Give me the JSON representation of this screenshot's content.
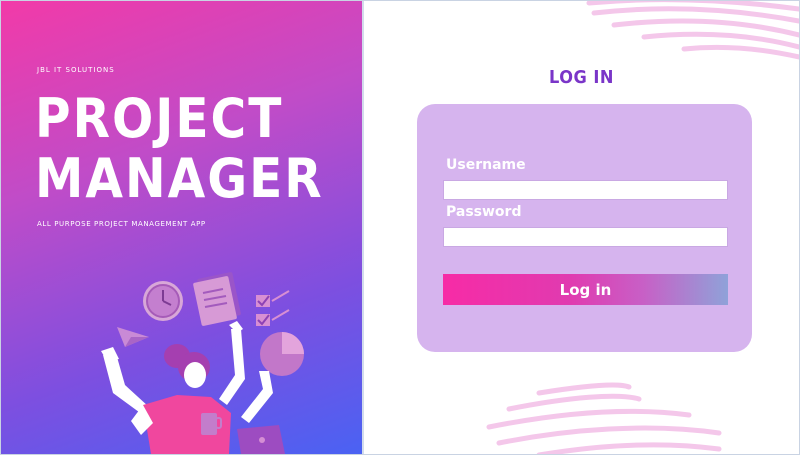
{
  "brand": {
    "company": "JBL IT SOLUTIONS",
    "title_line1": "PROJECT",
    "title_line2": "MANAGER",
    "tagline": "ALL PURPOSE PROJECT MANAGEMENT APP"
  },
  "login": {
    "heading": "LOG IN",
    "username_label": "Username",
    "username_value": "",
    "password_label": "Password",
    "password_value": "",
    "button_label": "Log in"
  },
  "colors": {
    "accent_pink": "#f72ba6",
    "accent_purple": "#7a35c8",
    "card_background": "#d6b4ee",
    "left_gradient_start": "#f23aa8",
    "left_gradient_end": "#4a62f3"
  },
  "icons": [
    "clock-icon",
    "document-icon",
    "checklist-icon",
    "pie-chart-icon",
    "paper-plane-icon",
    "coffee-mug-icon",
    "laptop-icon"
  ]
}
